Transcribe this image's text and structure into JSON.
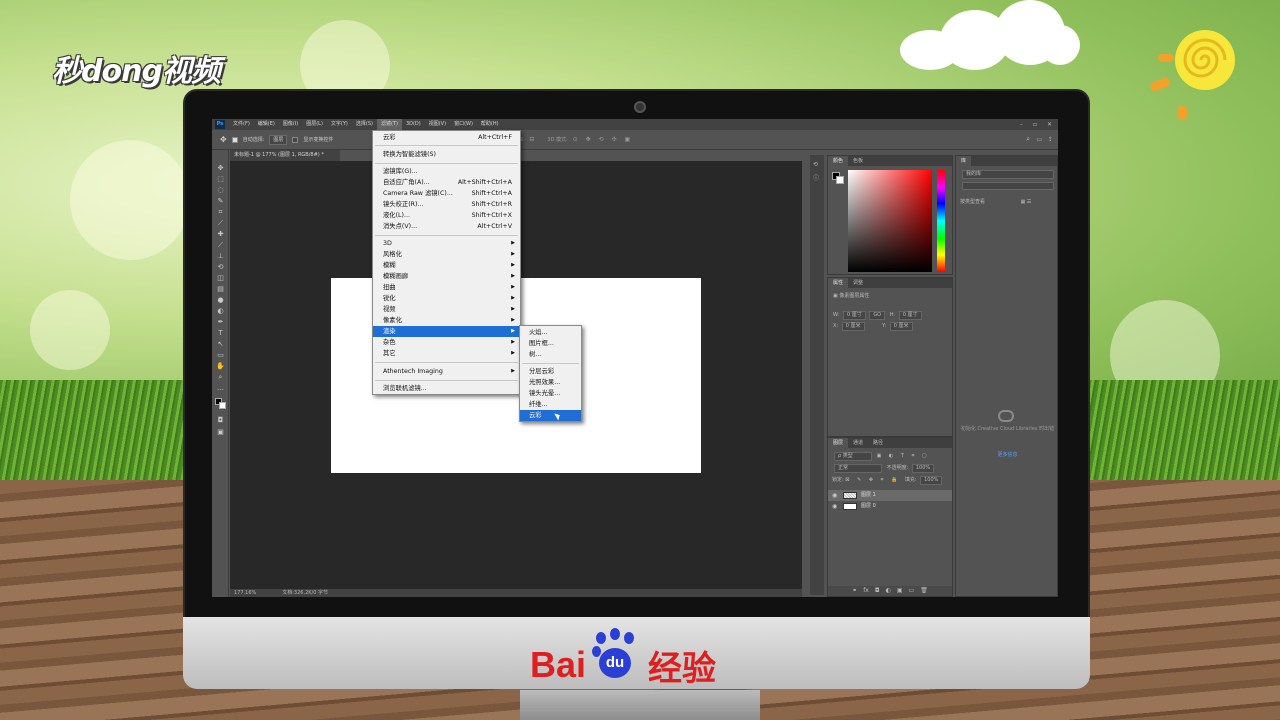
{
  "watermark": {
    "brand_text": "秒dong视频"
  },
  "footer_brand": {
    "latin": "Bai",
    "paw_text": "du",
    "chinese": "经验"
  },
  "menubar": {
    "items": [
      "文件(F)",
      "编辑(E)",
      "图像(I)",
      "图层(L)",
      "文字(Y)",
      "选择(S)",
      "滤镜(T)",
      "3D(D)",
      "视图(V)",
      "窗口(W)",
      "帮助(H)"
    ],
    "active_index": 6
  },
  "options_bar": {
    "auto_select_label": "自动选择:",
    "auto_select_value": "图层",
    "transform_label": "显示变换控件",
    "mode_3d_label": "3D 模式:"
  },
  "document": {
    "tab_title": "未标题-1 @ 177% (图层 1, RGB/8#) *",
    "zoom": "177.16%",
    "doc_info": "文档:326.2K/0 字节"
  },
  "filter_menu": {
    "last_filter": {
      "label": "云彩",
      "shortcut": "Alt+Ctrl+F"
    },
    "smart_filter": "转换为智能滤镜(S)",
    "group1": [
      {
        "label": "滤镜库(G)...",
        "shortcut": ""
      },
      {
        "label": "自适应广角(A)...",
        "shortcut": "Alt+Shift+Ctrl+A"
      },
      {
        "label": "Camera Raw 滤镜(C)...",
        "shortcut": "Shift+Ctrl+A"
      },
      {
        "label": "镜头校正(R)...",
        "shortcut": "Shift+Ctrl+R"
      },
      {
        "label": "液化(L)...",
        "shortcut": "Shift+Ctrl+X"
      },
      {
        "label": "消失点(V)...",
        "shortcut": "Alt+Ctrl+V"
      }
    ],
    "submenus": [
      "3D",
      "风格化",
      "模糊",
      "模糊画廊",
      "扭曲",
      "锐化",
      "视频",
      "像素化",
      "渲染",
      "杂色",
      "其它"
    ],
    "highlighted_submenu": "渲染",
    "plugin": "Athentech Imaging",
    "browse": "浏览联机滤镜..."
  },
  "render_submenu": {
    "group1": [
      "火焰...",
      "图片框...",
      "树..."
    ],
    "group2": [
      "分层云彩",
      "光照效果...",
      "镜头光晕...",
      "纤维...",
      "云彩"
    ],
    "highlighted": "云彩"
  },
  "color_panel": {
    "tabs": [
      "颜色",
      "色板"
    ],
    "active_tab": 0
  },
  "properties_panel": {
    "tabs": [
      "属性",
      "调整"
    ],
    "title": "像素图层属性",
    "w_label": "W:",
    "w_value": "0 厘寸",
    "link_label": "GO",
    "h_label": "H:",
    "h_value": "0 厘寸",
    "x_label": "X:",
    "x_value": "0 厘米",
    "y_label": "Y:",
    "y_value": "0 厘米"
  },
  "layers_panel": {
    "tabs": [
      "图层",
      "通道",
      "路径"
    ],
    "filter_kind": "ρ 类型",
    "blend_mode": "正常",
    "opacity_label": "不透明度:",
    "opacity_value": "100%",
    "lock_label": "锁定:",
    "fill_label": "填充:",
    "fill_value": "100%",
    "layers": [
      {
        "name": "图层 1",
        "selected": true
      },
      {
        "name": "图层 0",
        "selected": false
      }
    ],
    "footer_icons": [
      "fx",
      "◘",
      "◐",
      "▣",
      "▭",
      "🗑"
    ]
  },
  "library_panel": {
    "tab": "库",
    "dropdown": "我的库",
    "view_label": "按类型查看",
    "message": "初始化 Creative Cloud Libraries 时出错",
    "link": "更多信息"
  }
}
